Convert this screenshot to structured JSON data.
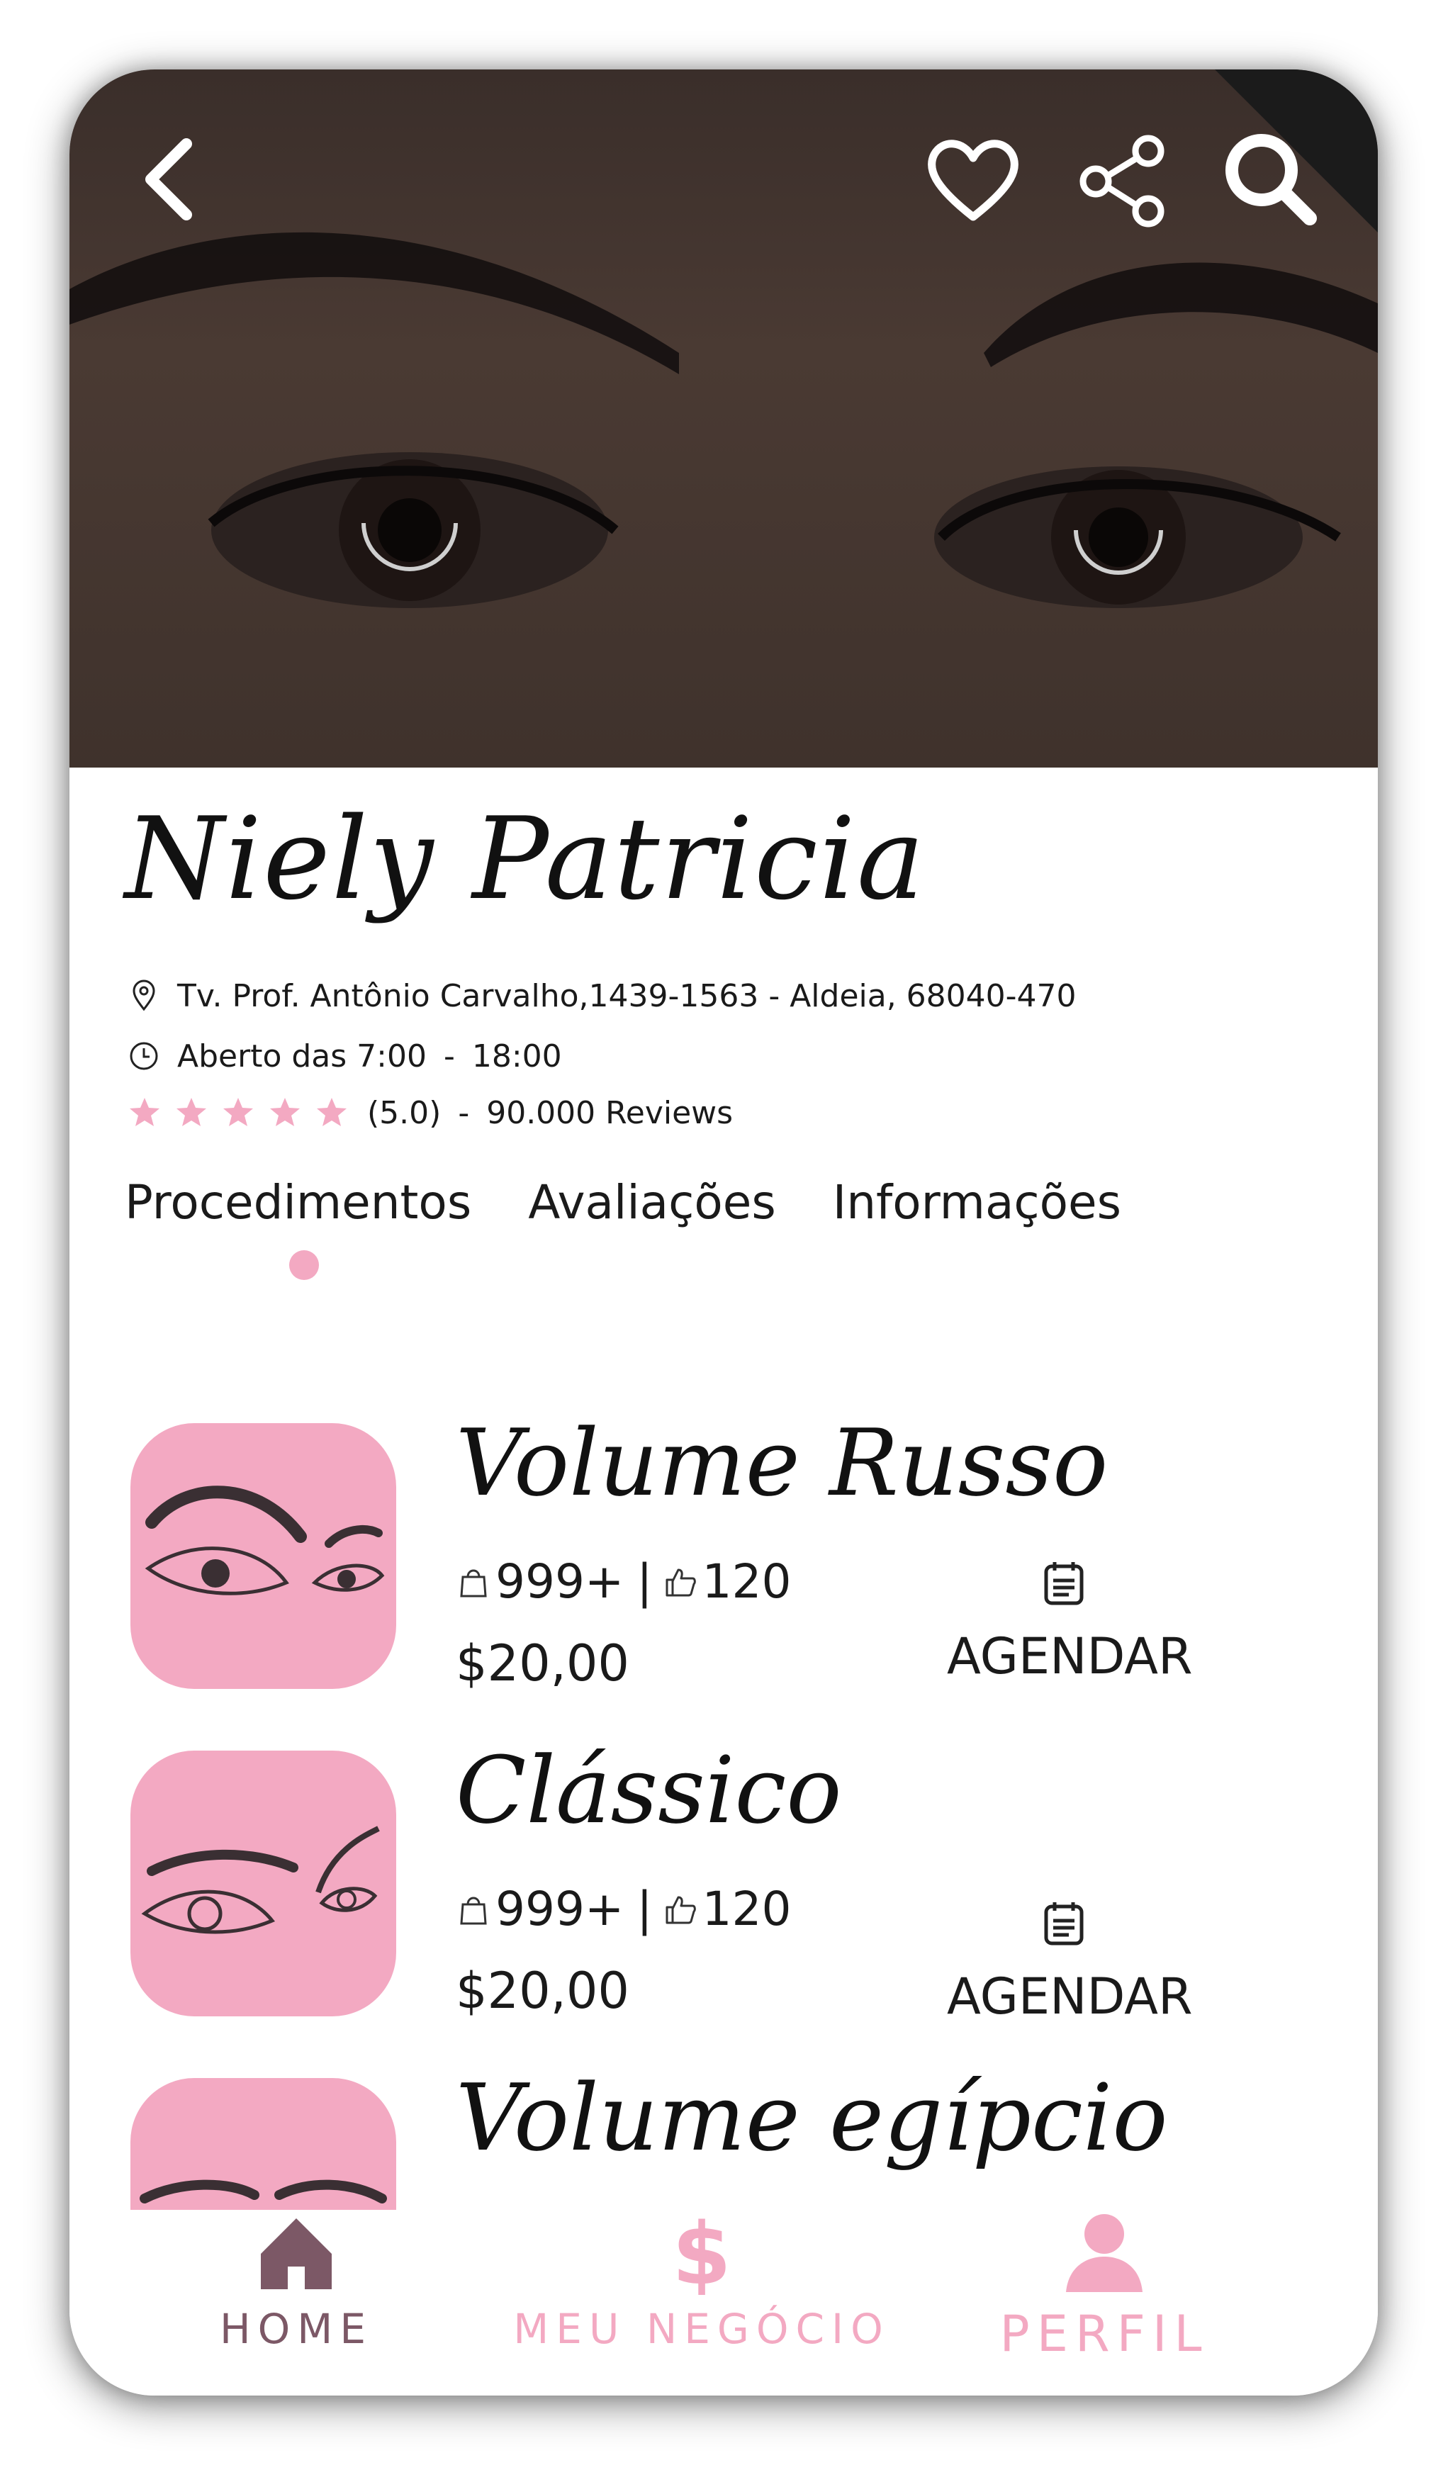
{
  "colors": {
    "accent": "#f3a9c2",
    "home_active": "#7c5866",
    "text": "#1a1a1a"
  },
  "header": {
    "back_icon": "chevron-left-icon",
    "favorite_icon": "heart-icon",
    "share_icon": "share-icon",
    "search_icon": "search-icon"
  },
  "profile": {
    "name": "Niely Patricia",
    "address": "Tv. Prof. Antônio Carvalho,1439-1563 - Aldeia, 68040-470",
    "hours_label": "Aberto das 7:00",
    "hours_separator": "-",
    "hours_close": "18:00",
    "rating_value": 5.0,
    "rating_text": "(5.0)",
    "rating_separator": "-",
    "reviews": "90.000 Reviews"
  },
  "tabs": {
    "active": "Procedimentos",
    "items": [
      "Procedimentos",
      "Avaliações",
      "Informações"
    ]
  },
  "procedures": [
    {
      "title": "Volume Russo",
      "sales": "999+",
      "separator": "|",
      "likes": "120",
      "price": "$20,00",
      "action": "AGENDAR"
    },
    {
      "title": "Clássico",
      "sales": "999+",
      "separator": "|",
      "likes": "120",
      "price": "$20,00",
      "action": "AGENDAR"
    },
    {
      "title": "Volume egípcio"
    }
  ],
  "bottom_nav": {
    "home": "HOME",
    "business": "MEU NEGÓCIO",
    "profile": "PERFIL"
  }
}
